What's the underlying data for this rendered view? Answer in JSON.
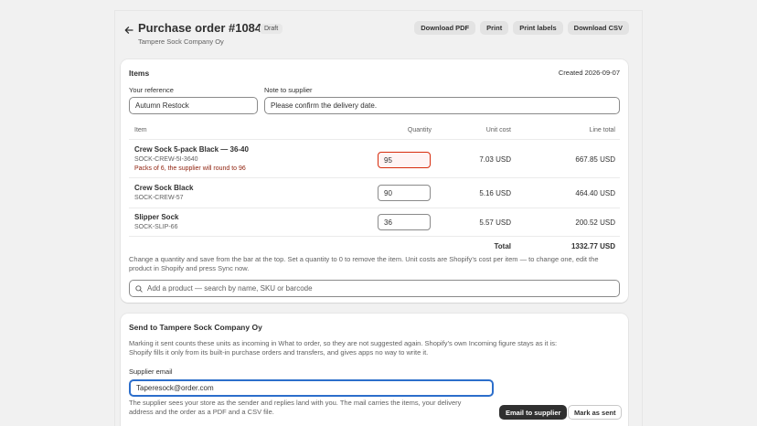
{
  "header": {
    "title": "Purchase order #1084",
    "status": "Draft",
    "supplier": "Tampere Sock Company Oy",
    "buttons": {
      "download_pdf": "Download PDF",
      "print": "Print",
      "print_labels": "Print labels",
      "download_csv": "Download CSV"
    },
    "back_icon": "arrow-left-icon"
  },
  "items_card": {
    "title": "Items",
    "created": "Created 2026-09-07",
    "reference_label": "Your reference",
    "reference_value": "Autumn Restock",
    "note_label": "Note to supplier",
    "note_value": "Please confirm the delivery date.",
    "columns": {
      "item": "Item",
      "quantity": "Quantity",
      "unit_cost": "Unit cost",
      "line_total": "Line total"
    },
    "rows": [
      {
        "name": "Crew Sock 5-pack Black — 36-40",
        "sku": "SOCK-CREW-5I-3640",
        "warning": "Packs of 6, the supplier will round to 96",
        "quantity": "95",
        "unit_cost": "7.03 USD",
        "line_total": "667.85 USD"
      },
      {
        "name": "Crew Sock Black",
        "sku": "SOCK-CREW-57",
        "warning": "",
        "quantity": "90",
        "unit_cost": "5.16 USD",
        "line_total": "464.40 USD"
      },
      {
        "name": "Slipper Sock",
        "sku": "SOCK-SLIP-66",
        "warning": "",
        "quantity": "36",
        "unit_cost": "5.57 USD",
        "line_total": "200.52 USD"
      }
    ],
    "total_label": "Total",
    "total_value": "1332.77 USD",
    "help_line1": "Change a quantity and save from the bar at the top. Set a quantity to 0 to remove the item. Unit costs are Shopify’s cost per item — to change one, edit the",
    "help_line2": "product in Shopify and press Sync now.",
    "search_placeholder": "Add a product — search by name, SKU or barcode",
    "search_icon": "search-icon"
  },
  "send_card": {
    "title": "Send to Tampere Sock Company Oy",
    "info_line1": "Marking it sent counts these units as incoming in What to order, so they are not suggested again. Shopify’s own Incoming figure stays as it is:",
    "info_line2": "Shopify fills it only from its built-in purchase orders and transfers, and gives apps no way to write it.",
    "email_label": "Supplier email",
    "email_value": "Taperesock@order.com",
    "note_line1": "The supplier sees your store as the sender and replies land with you. The mail carries the items, your delivery",
    "note_line2": "address and the order as a PDF and a CSV file.",
    "email_button": "Email to supplier",
    "mark_sent_button": "Mark as sent"
  },
  "colors": {
    "accent": "#2c6ecb",
    "error": "#d72c0d",
    "warning_text": "#8e1f0b",
    "primary_button": "#303030"
  }
}
